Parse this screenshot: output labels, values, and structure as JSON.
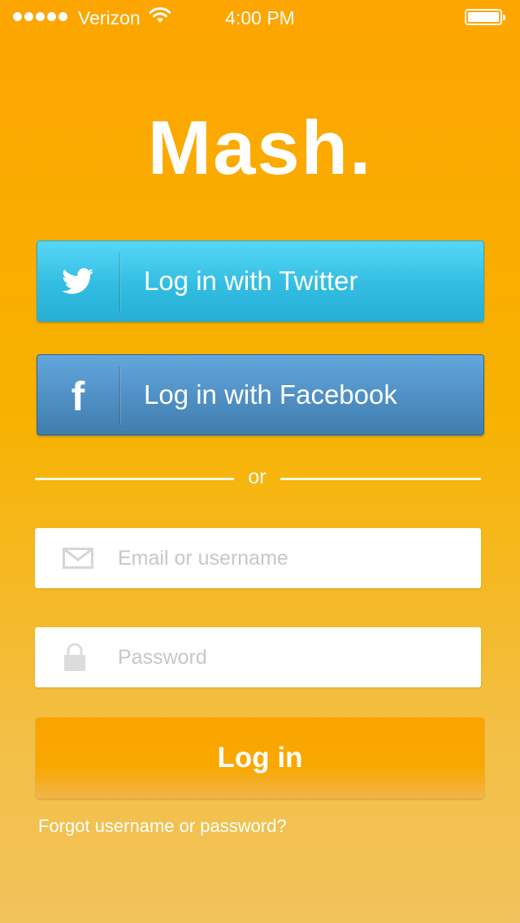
{
  "status_bar": {
    "carrier": "Verizon",
    "time": "4:00 PM",
    "signal_icon": "signal-dots-icon",
    "wifi_icon": "wifi-icon",
    "battery_icon": "battery-icon"
  },
  "logo": {
    "text": "Mash."
  },
  "social": {
    "twitter_label": "Log in with Twitter",
    "twitter_icon": "twitter-bird-icon",
    "facebook_label": "Log in with Facebook",
    "facebook_icon": "facebook-f-icon",
    "facebook_glyph": "f"
  },
  "separator": {
    "text": "or"
  },
  "form": {
    "email_placeholder": "Email or username",
    "email_value": "",
    "email_icon": "envelope-icon",
    "password_placeholder": "Password",
    "password_value": "",
    "password_icon": "lock-icon",
    "login_label": "Log in",
    "forgot_label": "Forgot username or password?"
  },
  "colors": {
    "background_top": "#fda500",
    "background_bottom": "#f2c35c",
    "twitter_blue": "#33bde2",
    "facebook_blue": "#4f8fc3",
    "login_orange": "#f9a800"
  }
}
